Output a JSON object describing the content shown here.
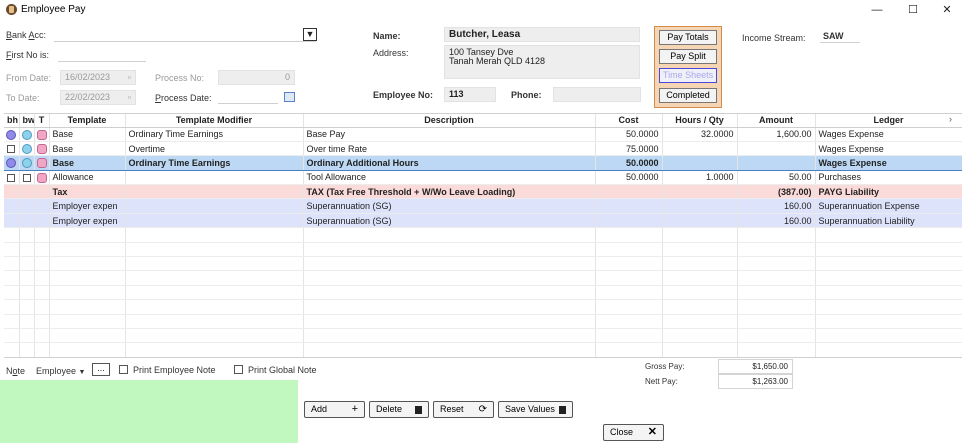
{
  "window": {
    "title": "Employee Pay",
    "minimize": "—",
    "maximize": "☐",
    "close": "✕"
  },
  "header": {
    "bank_acc_label": "Bank Acc:",
    "first_no_label": "First No is:",
    "from_date_label": "From Date:",
    "from_date": "16/02/2023",
    "to_date_label": "To Date:",
    "to_date": "22/02/2023",
    "process_no_label": "Process No:",
    "process_no": "0",
    "process_date_label": "Process Date:",
    "name_label": "Name:",
    "name": "Butcher, Leasa",
    "address_label": "Address:",
    "address_line1": "100 Tansey Dve",
    "address_line2": "Tanah Merah QLD 4128",
    "employee_no_label": "Employee No:",
    "employee_no": "113",
    "phone_label": "Phone:",
    "phone": "",
    "income_stream_label": "Income Stream:",
    "income_stream": "SAW"
  },
  "side_buttons": {
    "pay_totals": "Pay Totals",
    "pay_split": "Pay Split",
    "time_sheets": "Time Sheets",
    "completed": "Completed"
  },
  "grid": {
    "columns": [
      "bh",
      "bw",
      "T",
      "Template",
      "Template Modifier",
      "Description",
      "Cost",
      "Hours / Qty",
      "Amount",
      "Ledger"
    ],
    "rows": [
      {
        "template": "Base",
        "modifier": "Ordinary Time Earnings",
        "description": "Base Pay",
        "cost": "50.0000",
        "hours": "32.0000",
        "amount": "1,600.00",
        "ledger": "Wages Expense"
      },
      {
        "template": "Base",
        "modifier": "Overtime",
        "description": "Over time Rate",
        "cost": "75.0000",
        "hours": "",
        "amount": "",
        "ledger": "Wages Expense"
      },
      {
        "template": "Base",
        "modifier": "Ordinary Time Earnings",
        "description": "Ordinary Additional Hours",
        "cost": "50.0000",
        "hours": "",
        "amount": "",
        "ledger": "Wages Expense"
      },
      {
        "template": "Allowance",
        "modifier": "",
        "description": "Tool Allowance",
        "cost": "50.0000",
        "hours": "1.0000",
        "amount": "50.00",
        "ledger": "Purchases"
      },
      {
        "template": "Tax",
        "modifier": "",
        "description": "TAX (Tax Free Threshold  + W/Wo Leave Loading)",
        "cost": "",
        "hours": "",
        "amount": "(387.00)",
        "ledger": "PAYG Liability"
      },
      {
        "template": "Employer expen",
        "modifier": "",
        "description": "Superannuation (SG)",
        "cost": "",
        "hours": "",
        "amount": "160.00",
        "ledger": "Superannuation Expense"
      },
      {
        "template": "Employer expen",
        "modifier": "",
        "description": "Superannuation (SG)",
        "cost": "",
        "hours": "",
        "amount": "160.00",
        "ledger": "Superannuation Liability"
      }
    ]
  },
  "footer": {
    "note_label": "Note",
    "note_type": "Employee",
    "note_btn": "...",
    "print_employee_note": "Print Employee Note",
    "print_global_note": "Print Global Note",
    "gross_pay_label": "Gross Pay:",
    "gross_pay": "$1,650.00",
    "net_pay_label": "Nett Pay:",
    "net_pay": "$1,263.00",
    "add": "Add",
    "delete": "Delete",
    "reset": "Reset",
    "save_values": "Save Values",
    "close": "Close"
  },
  "colors": {
    "tax_row": "#fbdada",
    "employer_row": "#dde3fb",
    "selected_row": "#bcd8f4",
    "note_area": "#c0f8c0",
    "button_panel": "#f6d5b5"
  }
}
